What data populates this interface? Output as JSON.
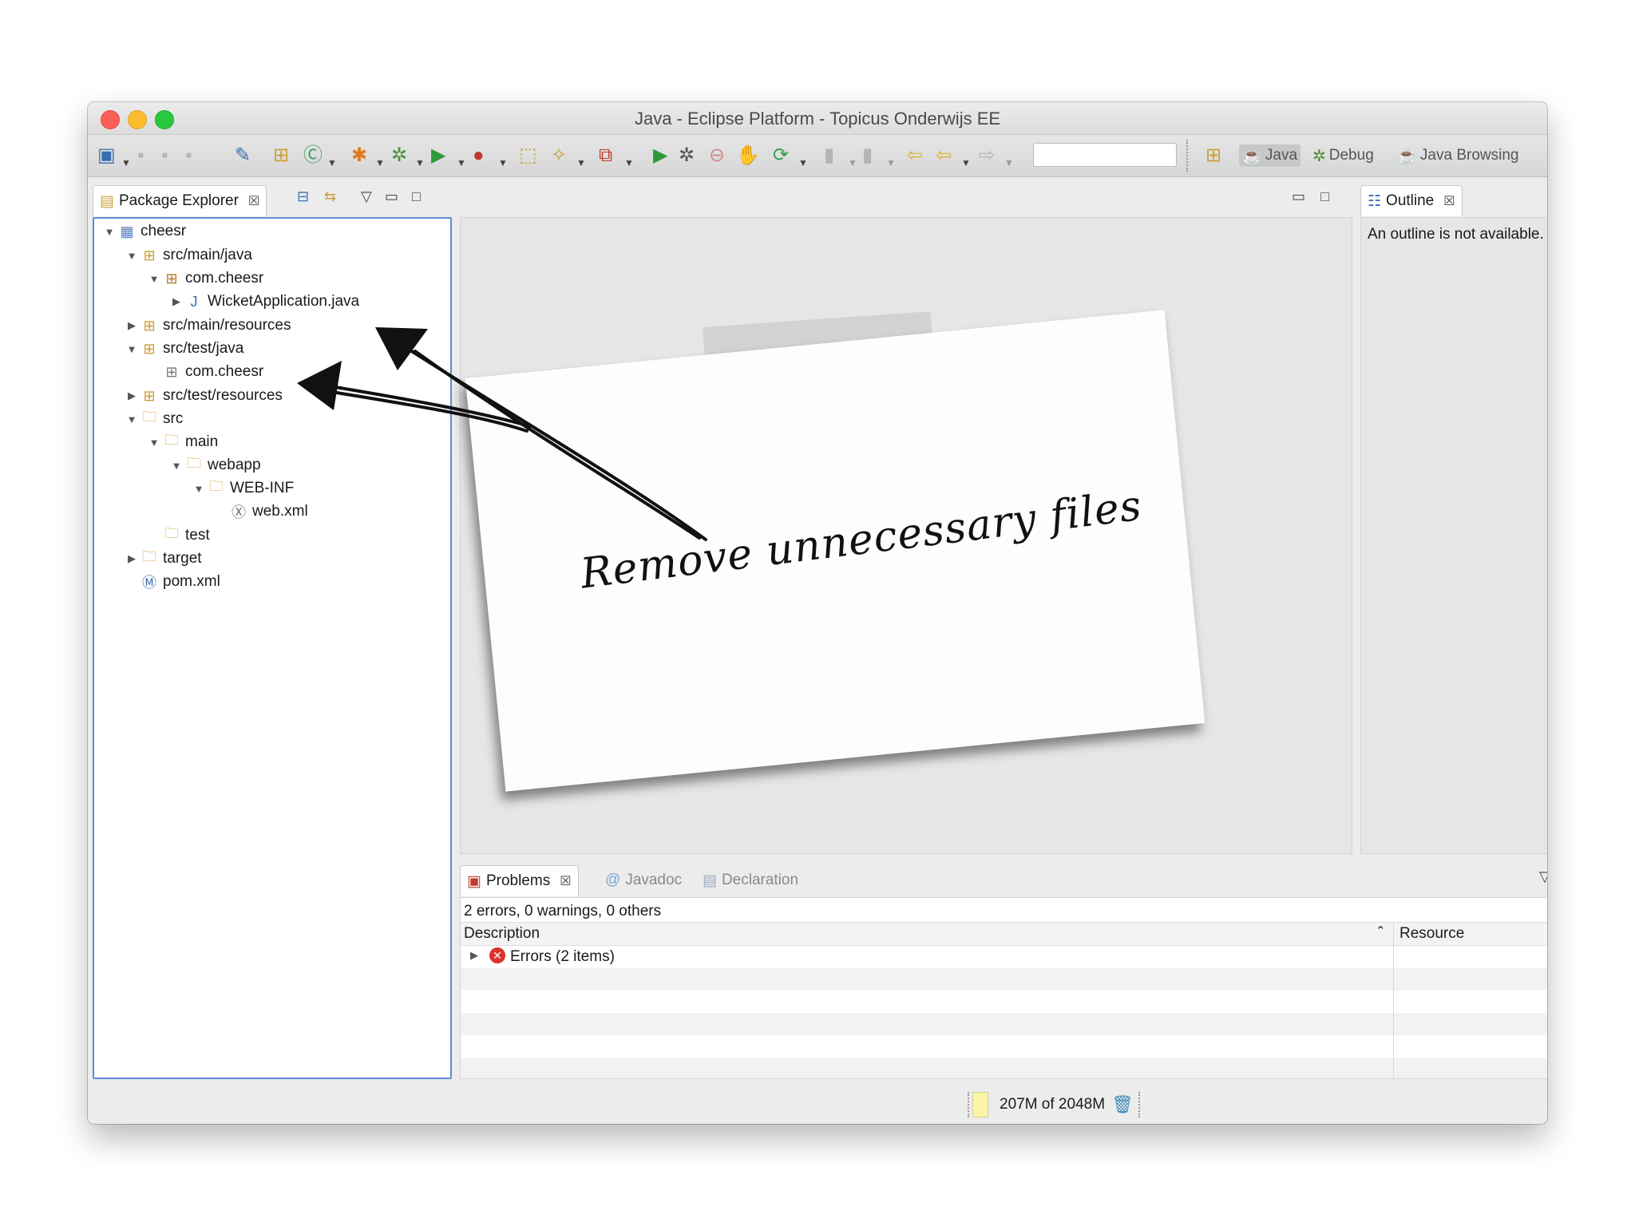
{
  "window": {
    "title": "Java - Eclipse Platform - Topicus Onderwijs EE"
  },
  "perspectives": [
    {
      "label": "Java"
    },
    {
      "label": "Debug"
    },
    {
      "label": "Java Browsing"
    }
  ],
  "package_explorer": {
    "tab_label": "Package Explorer",
    "tree": [
      {
        "label": "cheesr",
        "icon": "project-icon"
      },
      {
        "label": "src/main/java",
        "icon": "source-folder-icon"
      },
      {
        "label": "com.cheesr",
        "icon": "package-icon"
      },
      {
        "label": "WicketApplication.java",
        "icon": "java-file-icon"
      },
      {
        "label": "src/main/resources",
        "icon": "source-folder-icon"
      },
      {
        "label": "src/test/java",
        "icon": "source-folder-icon"
      },
      {
        "label": "com.cheesr",
        "icon": "empty-package-icon"
      },
      {
        "label": "src/test/resources",
        "icon": "source-folder-icon"
      },
      {
        "label": "src",
        "icon": "folder-icon"
      },
      {
        "label": "main",
        "icon": "folder-icon"
      },
      {
        "label": "webapp",
        "icon": "folder-icon"
      },
      {
        "label": "WEB-INF",
        "icon": "folder-icon"
      },
      {
        "label": "web.xml",
        "icon": "xml-file-icon"
      },
      {
        "label": "test",
        "icon": "folder-icon"
      },
      {
        "label": "target",
        "icon": "folder-icon"
      },
      {
        "label": "pom.xml",
        "icon": "maven-file-icon"
      }
    ]
  },
  "note": {
    "text": "Remove unnecessary files"
  },
  "outline": {
    "tab_label": "Outline",
    "message": "An outline is not available."
  },
  "bottom_panel": {
    "tabs": [
      {
        "label": "Problems"
      },
      {
        "label": "Javadoc"
      },
      {
        "label": "Declaration"
      }
    ],
    "summary": "2 errors, 0 warnings, 0 others",
    "columns": [
      "Description",
      "Resource"
    ],
    "rows": [
      {
        "description": "Errors (2 items)"
      }
    ]
  },
  "status": {
    "memory": "207M of 2048M"
  },
  "colors": {
    "selection_border": "#5a8ed6",
    "error": "#d9342b",
    "memory_bar": "#fbf5a8"
  }
}
